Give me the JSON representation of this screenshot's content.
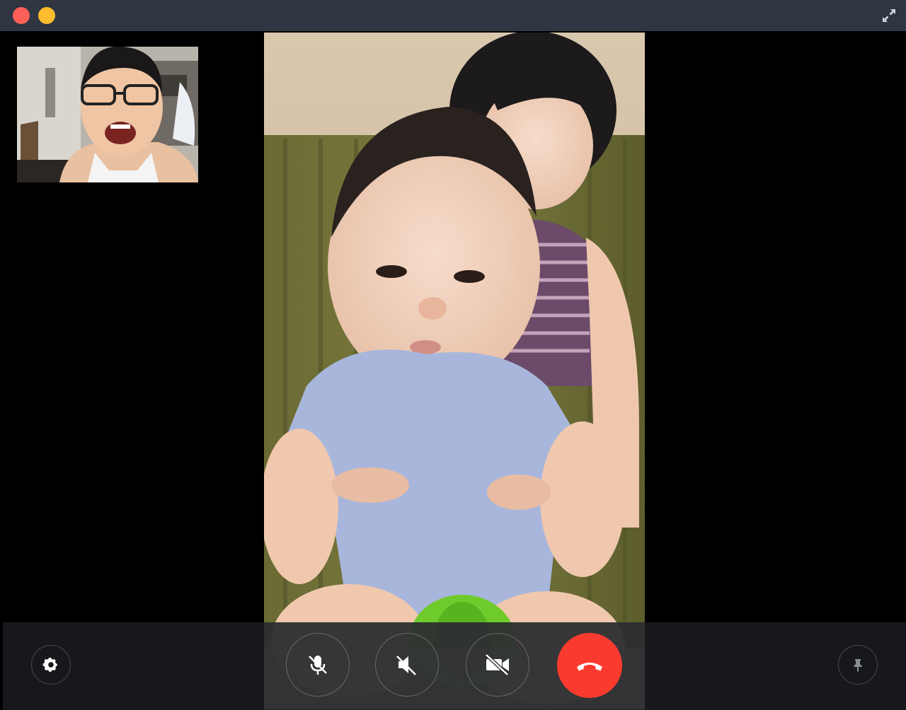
{
  "window": {
    "title": "",
    "accent_close": "#fc5f57",
    "accent_minimize": "#fdbb2e",
    "titlebar_color": "#2f3642"
  },
  "icons": {
    "close": "close-icon",
    "minimize": "minimize-icon",
    "expand": "expand-arrows-icon",
    "settings": "gear-icon",
    "mute_mic": "microphone-muted-icon",
    "mute_speaker": "speaker-muted-icon",
    "video_off": "video-camera-off-icon",
    "hangup": "phone-hangup-icon",
    "pin": "pin-icon"
  },
  "colors": {
    "hangup": "#fb3a2f",
    "control_border": "rgba(255,255,255,0.25)",
    "bottombar": "#181a1e"
  }
}
